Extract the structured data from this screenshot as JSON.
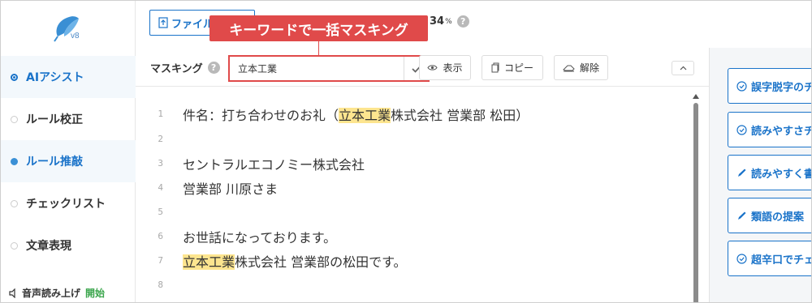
{
  "app": {
    "version": "v8"
  },
  "sidebar": {
    "items": [
      {
        "label": "AIアシスト",
        "state": "active"
      },
      {
        "label": "ルール校正",
        "state": "normal"
      },
      {
        "label": "ルール推敲",
        "state": "highlight"
      },
      {
        "label": "チェックリスト",
        "state": "normal"
      },
      {
        "label": "文章表現",
        "state": "normal"
      }
    ],
    "audio": {
      "label": "音声読み上げ",
      "action": "開始"
    }
  },
  "toolbar": {
    "file_button_label": "ファイル",
    "percent_value": "34",
    "percent_unit": "%",
    "help_glyph": "?"
  },
  "callout": {
    "text": "キーワードで一括マスキング"
  },
  "masking": {
    "label": "マスキング",
    "input_value": "立本工業",
    "buttons": {
      "show": "表示",
      "copy": "コピー",
      "release": "解除"
    }
  },
  "editor": {
    "lines": [
      {
        "num": "1",
        "segments": [
          {
            "t": "件名：打ち合わせのお礼（"
          },
          {
            "t": "立本工業",
            "hl": true
          },
          {
            "t": "株式会社 営業部 松田）"
          }
        ]
      },
      {
        "num": "2",
        "segments": []
      },
      {
        "num": "3",
        "segments": [
          {
            "t": "セントラルエコノミー株式会社"
          }
        ]
      },
      {
        "num": "4",
        "segments": [
          {
            "t": "営業部 川原さま"
          }
        ]
      },
      {
        "num": "5",
        "segments": []
      },
      {
        "num": "6",
        "segments": [
          {
            "t": "お世話になっております。"
          }
        ]
      },
      {
        "num": "7",
        "segments": [
          {
            "t": "立本工業",
            "hl": true
          },
          {
            "t": "株式会社 営業部の松田です。"
          }
        ]
      },
      {
        "num": "8",
        "segments": []
      }
    ]
  },
  "right_panel": {
    "buttons": [
      {
        "label": "誤字脱字のチェック",
        "icon": "check-circle-icon"
      },
      {
        "label": "読みやすさチェック",
        "icon": "check-circle-icon"
      },
      {
        "label": "読みやすく書き換え",
        "icon": "pencil-icon"
      },
      {
        "label": "類語の提案",
        "icon": "pencil-icon"
      },
      {
        "label": "超辛口でチェック",
        "icon": "check-circle-icon"
      }
    ]
  },
  "colors": {
    "accent": "#1a73c9",
    "callout": "#e04a4a",
    "highlight": "#fde58f",
    "audio_start": "#3aa54b"
  }
}
